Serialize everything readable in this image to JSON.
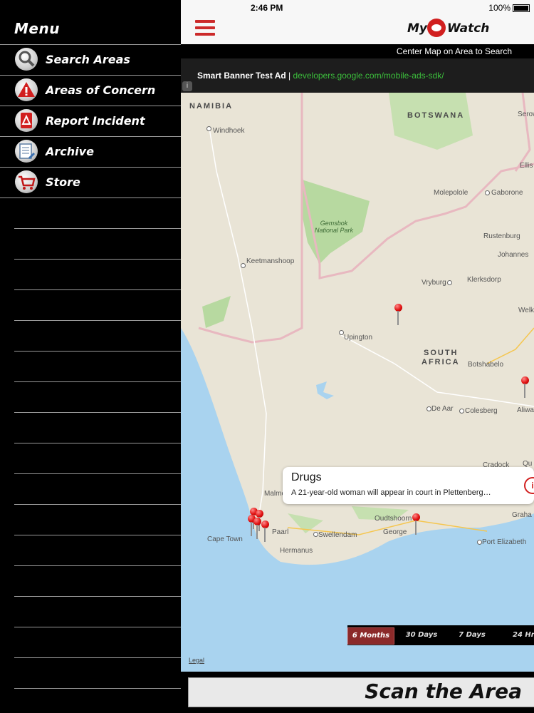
{
  "status": {
    "time": "2:46 PM",
    "battery": "100%"
  },
  "sidebar": {
    "title": "Menu",
    "items": [
      {
        "label": "Search Areas",
        "icon": "magnifier-icon"
      },
      {
        "label": "Areas of Concern",
        "icon": "warning-icon"
      },
      {
        "label": "Report Incident",
        "icon": "report-icon"
      },
      {
        "label": "Archive",
        "icon": "archive-icon"
      },
      {
        "label": "Store",
        "icon": "cart-icon"
      }
    ]
  },
  "header": {
    "logo_left": "My",
    "logo_right": "Watch"
  },
  "hint": {
    "text": "Center Map on Area to Search"
  },
  "ad": {
    "title": "Smart Banner Test Ad",
    "separator": "|",
    "link": "developers.google.com/mobile-ads-sdk/",
    "info": "i"
  },
  "map": {
    "countries": [
      "NAMIBIA",
      "BOTSWANA",
      "SOUTH",
      "AFRICA"
    ],
    "park": [
      "Gemsbok",
      "National Park"
    ],
    "cities": [
      "Windhoek",
      "Keetmanshoop",
      "Upington",
      "Molepolole",
      "Gaborone",
      "Rustenburg",
      "Johannes",
      "Klerksdorp",
      "Vryburg",
      "Welk",
      "Botshabelo",
      "Aliwa",
      "Colesberg",
      "De Aar",
      "Cradock",
      "Qu",
      "Malmesbury",
      "Paarl",
      "Cape Town",
      "Hermanus",
      "Swellendam",
      "Oudtshoorn",
      "George",
      "Port Elizabeth",
      "Graha",
      "Serow",
      "Ellis"
    ],
    "legal": "Legal"
  },
  "callout": {
    "title": "Drugs",
    "description": "A 21-year-old woman will appear in court in Plettenberg…",
    "info": "i"
  },
  "time_range": {
    "options": [
      "6 Months",
      "30 Days",
      "7 Days",
      "24 Hr"
    ],
    "selected": "6 Months"
  },
  "scan": {
    "label": "Scan the Area"
  },
  "colors": {
    "accent": "#cc2a2a",
    "ocean": "#a9d3ef",
    "land": "#e9e4d6",
    "park": "#b7d9a0",
    "border": "#e8b8c0"
  }
}
